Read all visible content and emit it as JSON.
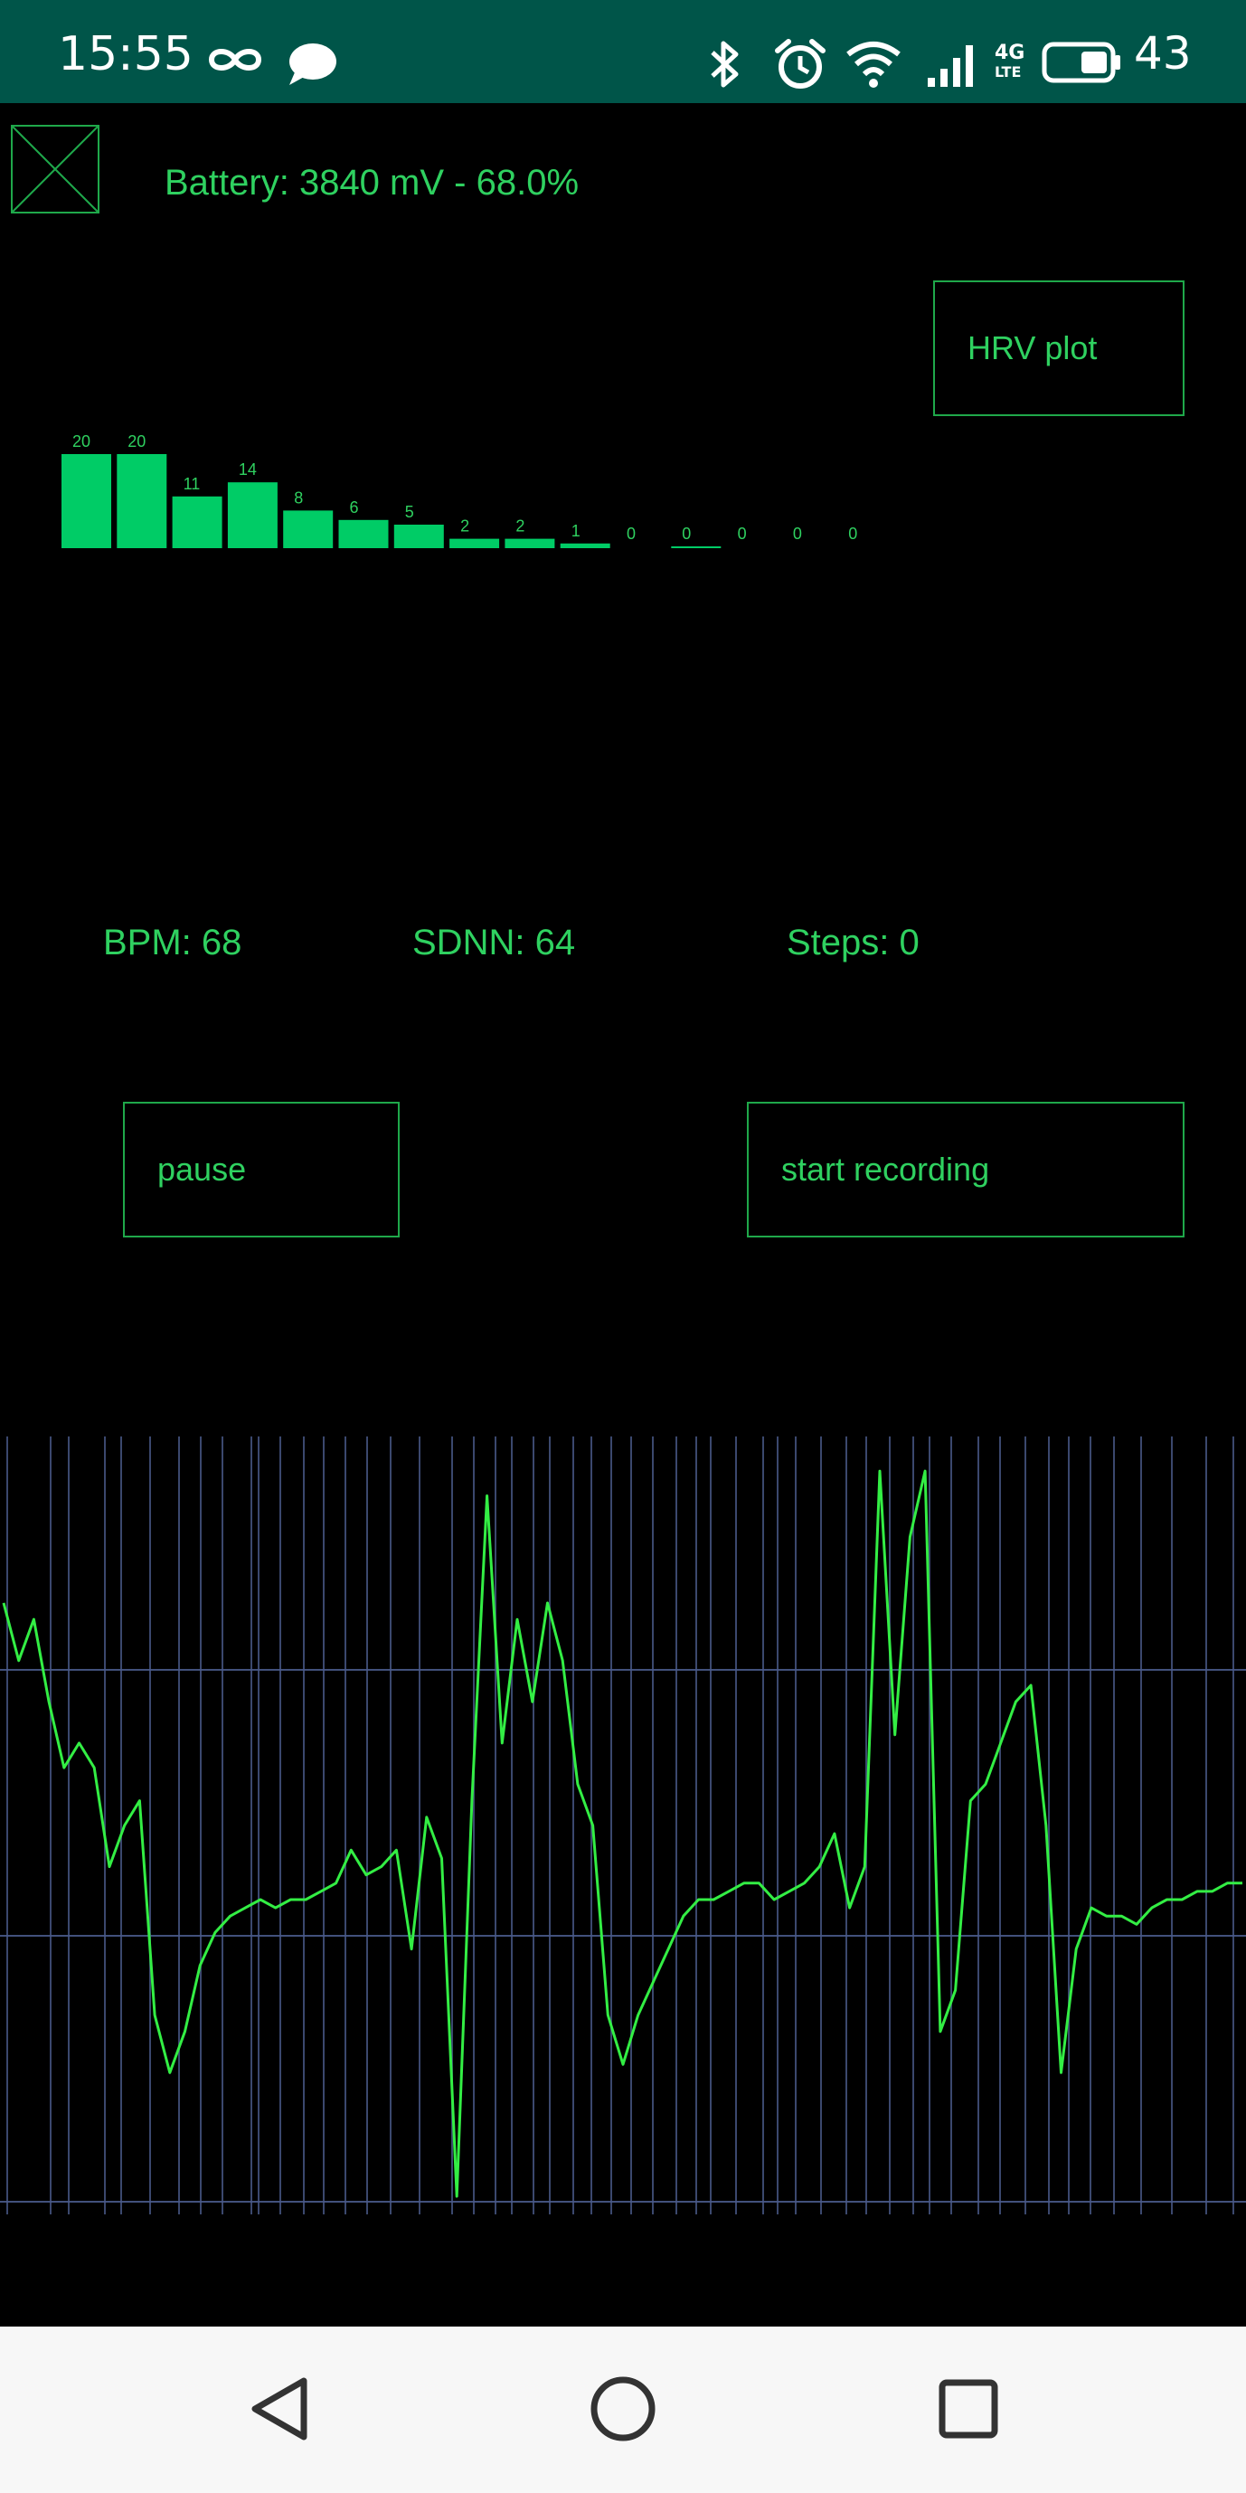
{
  "status_bar": {
    "time": "15:55",
    "battery_percent": "43",
    "icons": [
      "infinity-icon",
      "message-icon",
      "bluetooth-icon",
      "alarm-icon",
      "wifi-icon",
      "signal-icon",
      "4g-lte-icon",
      "battery-icon"
    ],
    "network_label": "4G",
    "network_sub": "LTE"
  },
  "app": {
    "battery_text": "Battery: 3840 mV - 68.0%",
    "hrv_button_label": "HRV plot",
    "pause_button_label": "pause",
    "record_button_label": "start recording",
    "stats": {
      "bpm": "BPM: 68",
      "sdnn": "SDNN: 64",
      "steps": "Steps: 0"
    },
    "accent_color": "#2fd160",
    "bar_color": "#00cc66",
    "grid_color": "#4a5a8a",
    "ecg_color": "#33ee44"
  },
  "chart_data": [
    {
      "type": "bar",
      "values": [
        20,
        20,
        11,
        14,
        8,
        6,
        5,
        2,
        2,
        1,
        0,
        0,
        0,
        0,
        0
      ],
      "labels": [
        "20",
        "20",
        "11",
        "14",
        "8",
        "6",
        "5",
        "2",
        "2",
        "1",
        "0",
        "0",
        "0",
        "0",
        "0"
      ],
      "ylim": [
        0,
        20
      ]
    },
    {
      "type": "line",
      "y": [
        0.28,
        0.35,
        0.3,
        0.4,
        0.48,
        0.45,
        0.48,
        0.6,
        0.55,
        0.52,
        0.78,
        0.85,
        0.8,
        0.72,
        0.68,
        0.66,
        0.65,
        0.64,
        0.65,
        0.64,
        0.64,
        0.63,
        0.62,
        0.58,
        0.61,
        0.6,
        0.58,
        0.7,
        0.54,
        0.59,
        1.0,
        0.52,
        0.15,
        0.45,
        0.3,
        0.4,
        0.28,
        0.35,
        0.5,
        0.55,
        0.78,
        0.84,
        0.78,
        0.74,
        0.7,
        0.66,
        0.64,
        0.64,
        0.63,
        0.62,
        0.62,
        0.64,
        0.63,
        0.62,
        0.6,
        0.56,
        0.65,
        0.6,
        0.12,
        0.44,
        0.2,
        0.12,
        0.8,
        0.75,
        0.52,
        0.5,
        0.45,
        0.4,
        0.38,
        0.55,
        0.85,
        0.7,
        0.65,
        0.66,
        0.66,
        0.67,
        0.65,
        0.64,
        0.64,
        0.63,
        0.63,
        0.62,
        0.62
      ]
    }
  ]
}
